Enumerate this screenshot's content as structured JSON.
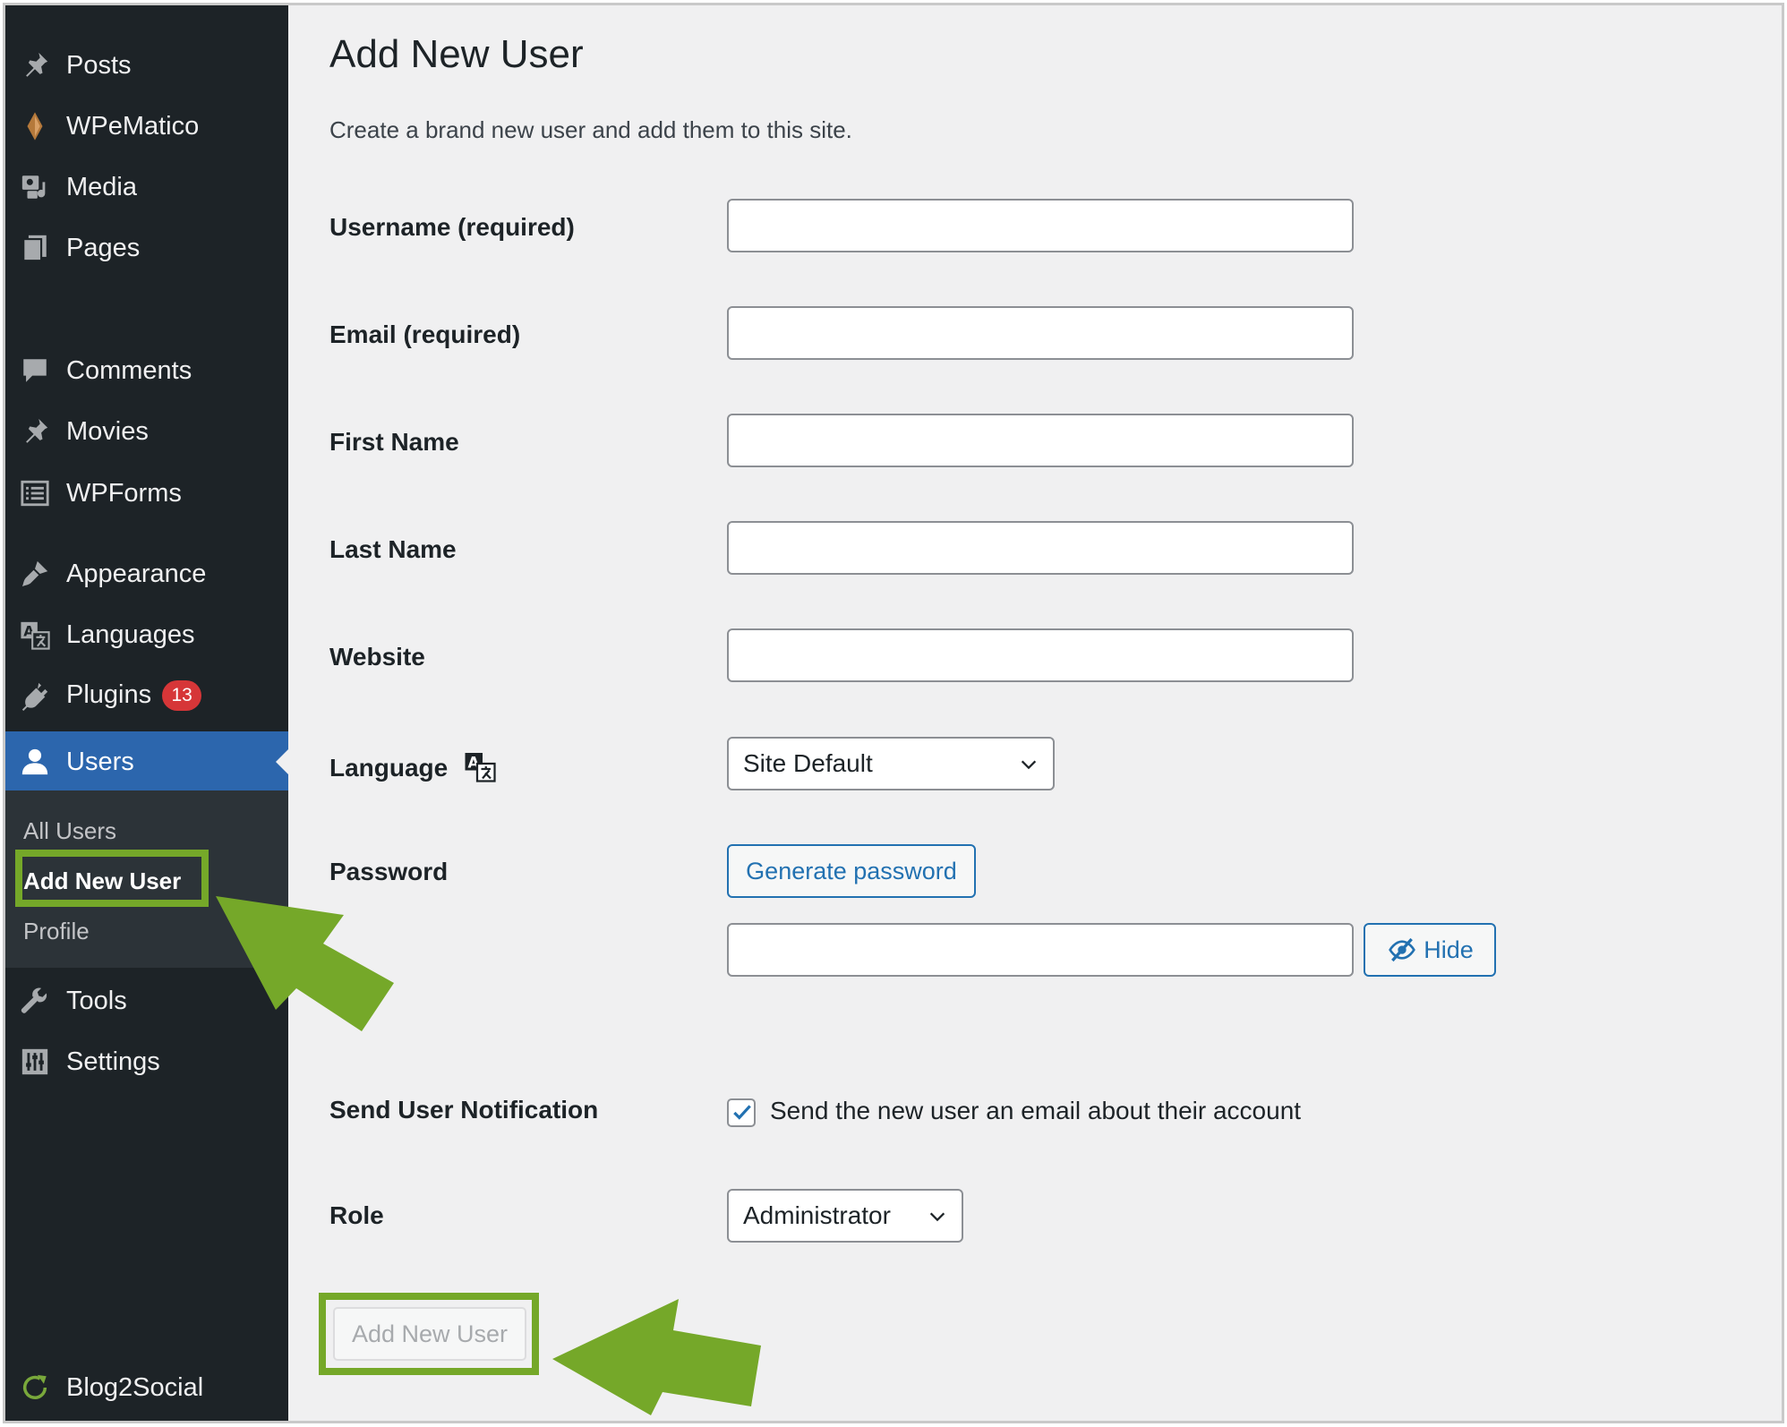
{
  "sidebar": {
    "items": [
      {
        "label": "Posts",
        "icon": "pin-icon"
      },
      {
        "label": "WPeMatico",
        "icon": "wpematico-icon"
      },
      {
        "label": "Media",
        "icon": "media-icon"
      },
      {
        "label": "Pages",
        "icon": "pages-icon"
      },
      {
        "label": "Comments",
        "icon": "comment-icon"
      },
      {
        "label": "Movies",
        "icon": "pin-icon"
      },
      {
        "label": "WPForms",
        "icon": "forms-icon"
      },
      {
        "label": "Appearance",
        "icon": "brush-icon"
      },
      {
        "label": "Languages",
        "icon": "translate-icon"
      },
      {
        "label": "Plugins",
        "icon": "plugin-icon",
        "badge": "13"
      },
      {
        "label": "Users",
        "icon": "user-icon",
        "active": true
      },
      {
        "label": "Tools",
        "icon": "wrench-icon"
      },
      {
        "label": "Settings",
        "icon": "sliders-icon"
      },
      {
        "label": "Blog2Social",
        "icon": "refresh-icon"
      }
    ],
    "submenu": [
      "All Users",
      "Add New User",
      "Profile"
    ],
    "current_submenu": "Add New User"
  },
  "page": {
    "title": "Add New User",
    "intro": "Create a brand new user and add them to this site."
  },
  "form": {
    "username_label": "Username (required)",
    "email_label": "Email (required)",
    "first_name_label": "First Name",
    "last_name_label": "Last Name",
    "website_label": "Website",
    "language_label": "Language",
    "language_value": "Site Default",
    "password_label": "Password",
    "generate_password_label": "Generate password",
    "hide_label": "Hide",
    "notification_label": "Send User Notification",
    "notification_text": "Send the new user an email about their account",
    "notification_checked": true,
    "role_label": "Role",
    "role_value": "Administrator",
    "submit_label": "Add New User"
  },
  "colors": {
    "sidebar_bg": "#1d2327",
    "active_menu": "#2c66ad",
    "accent": "#2271b1",
    "badge": "#d63638",
    "highlight": "#75a829"
  }
}
